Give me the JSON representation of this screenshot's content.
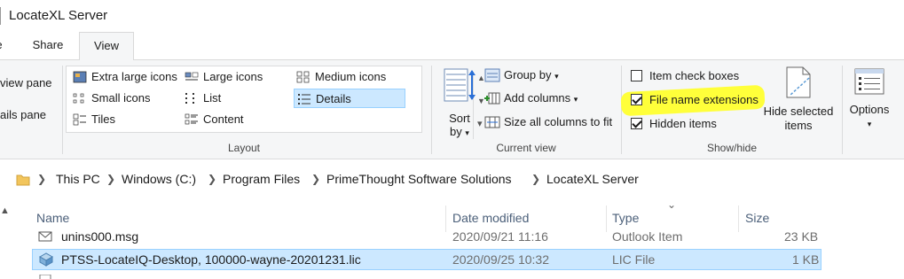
{
  "window": {
    "title": "LocateXL Server"
  },
  "tabs": {
    "file": "e",
    "share": "Share",
    "view": "View"
  },
  "panes": {
    "navigation_pane": "view pane",
    "details_pane": "ails pane"
  },
  "layout": {
    "label": "Layout",
    "items": [
      {
        "label": "Extra large icons",
        "icon": "extra-large-icons-icon"
      },
      {
        "label": "Large icons",
        "icon": "large-icons-icon"
      },
      {
        "label": "Medium icons",
        "icon": "medium-icons-icon"
      },
      {
        "label": "Small icons",
        "icon": "small-icons-icon"
      },
      {
        "label": "List",
        "icon": "list-icon"
      },
      {
        "label": "Details",
        "icon": "details-icon",
        "selected": true
      },
      {
        "label": "Tiles",
        "icon": "tiles-icon"
      },
      {
        "label": "Content",
        "icon": "content-icon"
      }
    ]
  },
  "current_view": {
    "label": "Current view",
    "sort_by_top": "Sort",
    "sort_by_bottom": "by",
    "group_by": "Group by",
    "add_columns": "Add columns",
    "size_all_columns": "Size all columns to fit"
  },
  "show_hide": {
    "label": "Show/hide",
    "item_check_boxes": {
      "label": "Item check boxes",
      "checked": false
    },
    "file_name_extensions": {
      "label": "File name extensions",
      "checked": true
    },
    "hidden_items": {
      "label": "Hidden items",
      "checked": true
    },
    "hide_selected_line1": "Hide selected",
    "hide_selected_line2": "items"
  },
  "options": {
    "label": "Options"
  },
  "address": {
    "crumbs": [
      "This PC",
      "Windows (C:)",
      "Program Files",
      "PrimeThought Software Solutions",
      "LocateXL Server"
    ]
  },
  "columns": {
    "name": "Name",
    "date_modified": "Date modified",
    "type": "Type",
    "size": "Size"
  },
  "files": [
    {
      "name": "unins000.msg",
      "date": "2020/09/21 11:16",
      "type": "Outlook Item",
      "size": "23 KB",
      "icon": "mail-file-icon"
    },
    {
      "name": "PTSS-LocateIQ-Desktop, 100000-wayne-20201231.lic",
      "date": "2020/09/25 10:32",
      "type": "LIC File",
      "size": "1 KB",
      "icon": "license-file-icon",
      "selected": true
    }
  ],
  "colors": {
    "selection": "#cce8ff",
    "highlight": "#ffff3a",
    "ribbon_bg": "#f5f6f7"
  }
}
